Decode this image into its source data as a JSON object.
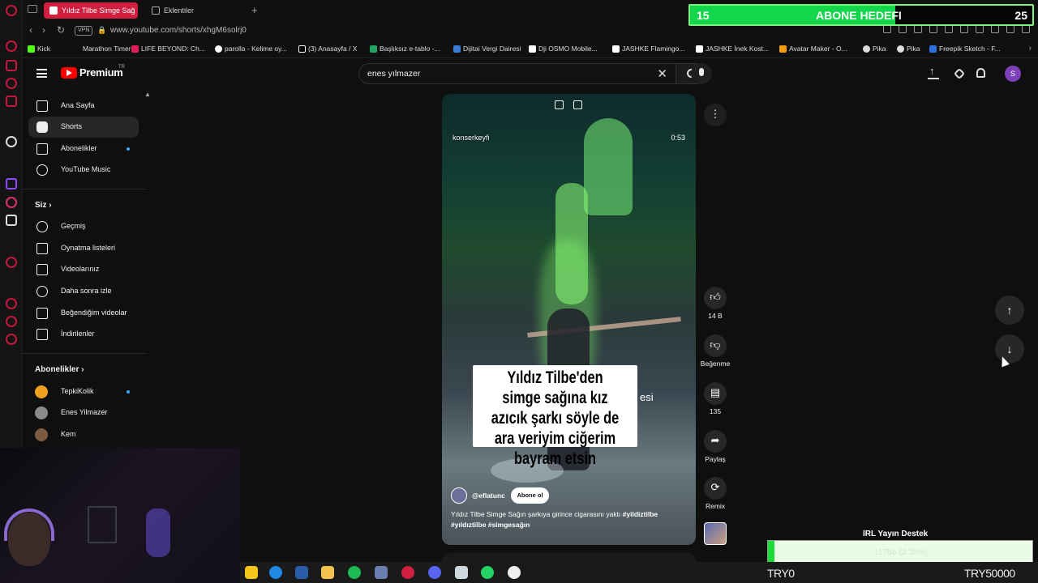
{
  "browser": {
    "tabs": [
      {
        "label": "Yıldız Tilbe Simge Sağ",
        "active": true
      },
      {
        "label": "Eklentiler",
        "active": false
      }
    ],
    "url": "www.youtube.com/shorts/xhgM6solrj0",
    "vpn_label": "VPN",
    "bookmarks": [
      "Kick",
      "Marathon Timer",
      "LIFE BEYOND: Ch...",
      "parolla - Kelime oy...",
      "(3) Anasayfa / X",
      "Başlıksız e-tablo -...",
      "Dijitai Vergi Dairesi",
      "Dji OSMO Mobile...",
      "JASHKE Flamingo...",
      "JASHKE İnek Kost...",
      "Avatar Maker - O...",
      "Pika",
      "Pika",
      "Freepik Sketch - F..."
    ]
  },
  "header": {
    "brand": "Premium",
    "country": "TR",
    "search_value": "enes yılmazer",
    "avatar_letter": "S"
  },
  "sidebar": {
    "main": [
      {
        "label": "Ana Sayfa",
        "icon": "home-icon"
      },
      {
        "label": "Shorts",
        "icon": "shorts-icon",
        "active": true
      },
      {
        "label": "Abonelikler",
        "icon": "subscriptions-icon",
        "dot": true
      },
      {
        "label": "YouTube Music",
        "icon": "music-icon"
      }
    ],
    "you_title": "Siz",
    "you": [
      {
        "label": "Geçmiş",
        "icon": "history-icon"
      },
      {
        "label": "Oynatma listeleri",
        "icon": "playlist-icon"
      },
      {
        "label": "Videolarınız",
        "icon": "video-icon"
      },
      {
        "label": "Daha sonra izle",
        "icon": "clock-icon"
      },
      {
        "label": "Beğendiğim videolar",
        "icon": "thumbs-up-icon"
      },
      {
        "label": "İndirilenler",
        "icon": "download-icon"
      }
    ],
    "subs_title": "Abonelikler",
    "subs": [
      {
        "label": "TepkiKolik",
        "dot": true
      },
      {
        "label": "Enes Yilmazer",
        "dot": false
      },
      {
        "label": "Kem",
        "dot": false
      }
    ]
  },
  "short": {
    "watermark": "konserkeyfi",
    "duration": "0:53",
    "caption": "Yıldız Tilbe'den simge sağına kız azıcık şarkı söyle de ara veriyim ciğerim bayram etsin",
    "overlay_tail": "esi",
    "channel": "@eflatunc",
    "subscribe_label": "Abone ol",
    "title": "Yıldız Tilbe Simge Sağın şarkıya girince cigarasını yaktı",
    "hashtags": [
      "#yildiztilbe",
      "#yıldıztilbe",
      "#simgesağın"
    ]
  },
  "actions": {
    "likes": "14 B",
    "dislike_label": "Beğenme",
    "comments": "135",
    "share_label": "Paylaş",
    "remix_label": "Remix"
  },
  "overlay": {
    "goal_current": "15",
    "goal_label": "ABONE HEDEFI",
    "goal_target": "25",
    "goal_progress": 0.6,
    "donation_title": "IRL Yayın Destek",
    "donation_text": "1175₺ (2.35%)",
    "donation_progress": 0.0235,
    "ticker_left": "TRY0",
    "ticker_right": "TRY50000"
  },
  "colors": {
    "accent": "#ff0000",
    "opera": "#d1203f",
    "goal_green": "#14d64c"
  }
}
